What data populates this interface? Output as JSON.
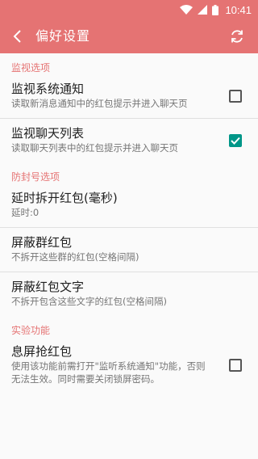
{
  "status_bar": {
    "time": "10:41"
  },
  "toolbar": {
    "title": "偏好设置"
  },
  "sections": {
    "monitor": {
      "header": "监视选项",
      "notify": {
        "title": "监视系统通知",
        "summary": "读取新消息通知中的红包提示并进入聊天页",
        "checked": false
      },
      "chatlist": {
        "title": "监视聊天列表",
        "summary": "读取聊天列表中的红包提示并进入聊天页",
        "checked": true
      }
    },
    "antiban": {
      "header": "防封号选项",
      "delay": {
        "title": "延时拆开红包(毫秒)",
        "summary": "延时:0"
      },
      "block_groups": {
        "title": "屏蔽群红包",
        "summary": "不拆开这些群的红包(空格间隔)"
      },
      "block_words": {
        "title": "屏蔽红包文字",
        "summary": "不拆开包含这些文字的红包(空格间隔)"
      }
    },
    "experimental": {
      "header": "实验功能",
      "screen_off": {
        "title": "息屏抢红包",
        "summary": "使用该功能前需打开\"监听系统通知\"功能，否则无法生效。同时需要关闭锁屏密码。",
        "checked": false
      }
    }
  },
  "colors": {
    "accent": "#e57373",
    "checkbox_checked": "#009688"
  }
}
